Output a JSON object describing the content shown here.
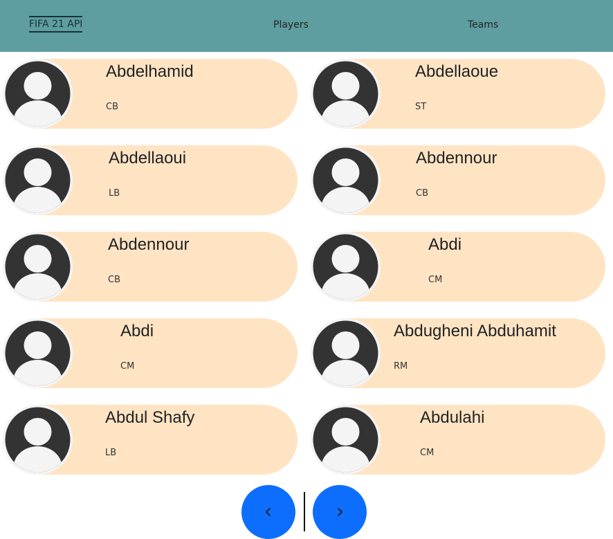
{
  "nav": {
    "brand": "FIFA 21 API",
    "players": "Players",
    "teams": "Teams"
  },
  "players": [
    {
      "name": "Abdelhamid",
      "position": "CB"
    },
    {
      "name": "Abdellaoue",
      "position": "ST"
    },
    {
      "name": "Abdellaoui",
      "position": "LB"
    },
    {
      "name": "Abdennour",
      "position": "CB"
    },
    {
      "name": "Abdennour",
      "position": "CB"
    },
    {
      "name": "Abdi",
      "position": "CM"
    },
    {
      "name": "Abdi",
      "position": "CM"
    },
    {
      "name": "Abdugheni Abduhamit",
      "position": "RM"
    },
    {
      "name": "Abdul Shafy",
      "position": "LB"
    },
    {
      "name": "Abdulahi",
      "position": "CM"
    }
  ],
  "pagination": {
    "prev_icon": "chevron-left-icon",
    "next_icon": "chevron-right-icon"
  },
  "colors": {
    "navbar": "#5f9ea0",
    "card": "#ffe4c4",
    "page_button": "#0d6efd"
  }
}
